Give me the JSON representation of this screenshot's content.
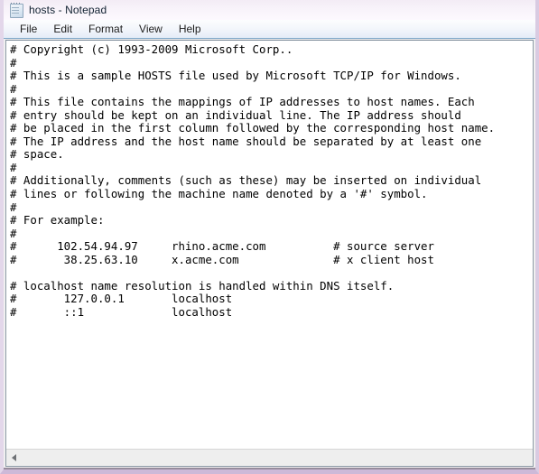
{
  "window": {
    "title": "hosts - Notepad",
    "app_icon": "notepad-icon"
  },
  "menu": {
    "items": [
      {
        "label": "File"
      },
      {
        "label": "Edit"
      },
      {
        "label": "Format"
      },
      {
        "label": "View"
      },
      {
        "label": "Help"
      }
    ]
  },
  "editor": {
    "document_name": "hosts",
    "lines": [
      "# Copyright (c) 1993-2009 Microsoft Corp..",
      "#",
      "# This is a sample HOSTS file used by Microsoft TCP/IP for Windows.",
      "#",
      "# This file contains the mappings of IP addresses to host names. Each",
      "# entry should be kept on an individual line. The IP address should",
      "# be placed in the first column followed by the corresponding host name.",
      "# The IP address and the host name should be separated by at least one",
      "# space.",
      "#",
      "# Additionally, comments (such as these) may be inserted on individual",
      "# lines or following the machine name denoted by a '#' symbol.",
      "#",
      "# For example:",
      "#",
      "#      102.54.94.97     rhino.acme.com          # source server",
      "#       38.25.63.10     x.acme.com              # x client host",
      "",
      "# localhost name resolution is handled within DNS itself.",
      "#       127.0.0.1       localhost",
      "#       ::1             localhost"
    ],
    "host_entries": [
      {
        "ip": "102.54.94.97",
        "hostname": "rhino.acme.com",
        "comment": "# source server"
      },
      {
        "ip": "38.25.63.10",
        "hostname": "x.acme.com",
        "comment": "# x client host"
      },
      {
        "ip": "127.0.0.1",
        "hostname": "localhost",
        "comment": ""
      },
      {
        "ip": "::1",
        "hostname": "localhost",
        "comment": ""
      }
    ]
  },
  "scrollbar": {
    "left_arrow_icon": "chevron-left-icon",
    "orientation": "horizontal"
  },
  "colors": {
    "window_border": "#cdb9d8",
    "menu_underline": "#7ea7c8",
    "text": "#000000",
    "editor_background": "#ffffff"
  }
}
